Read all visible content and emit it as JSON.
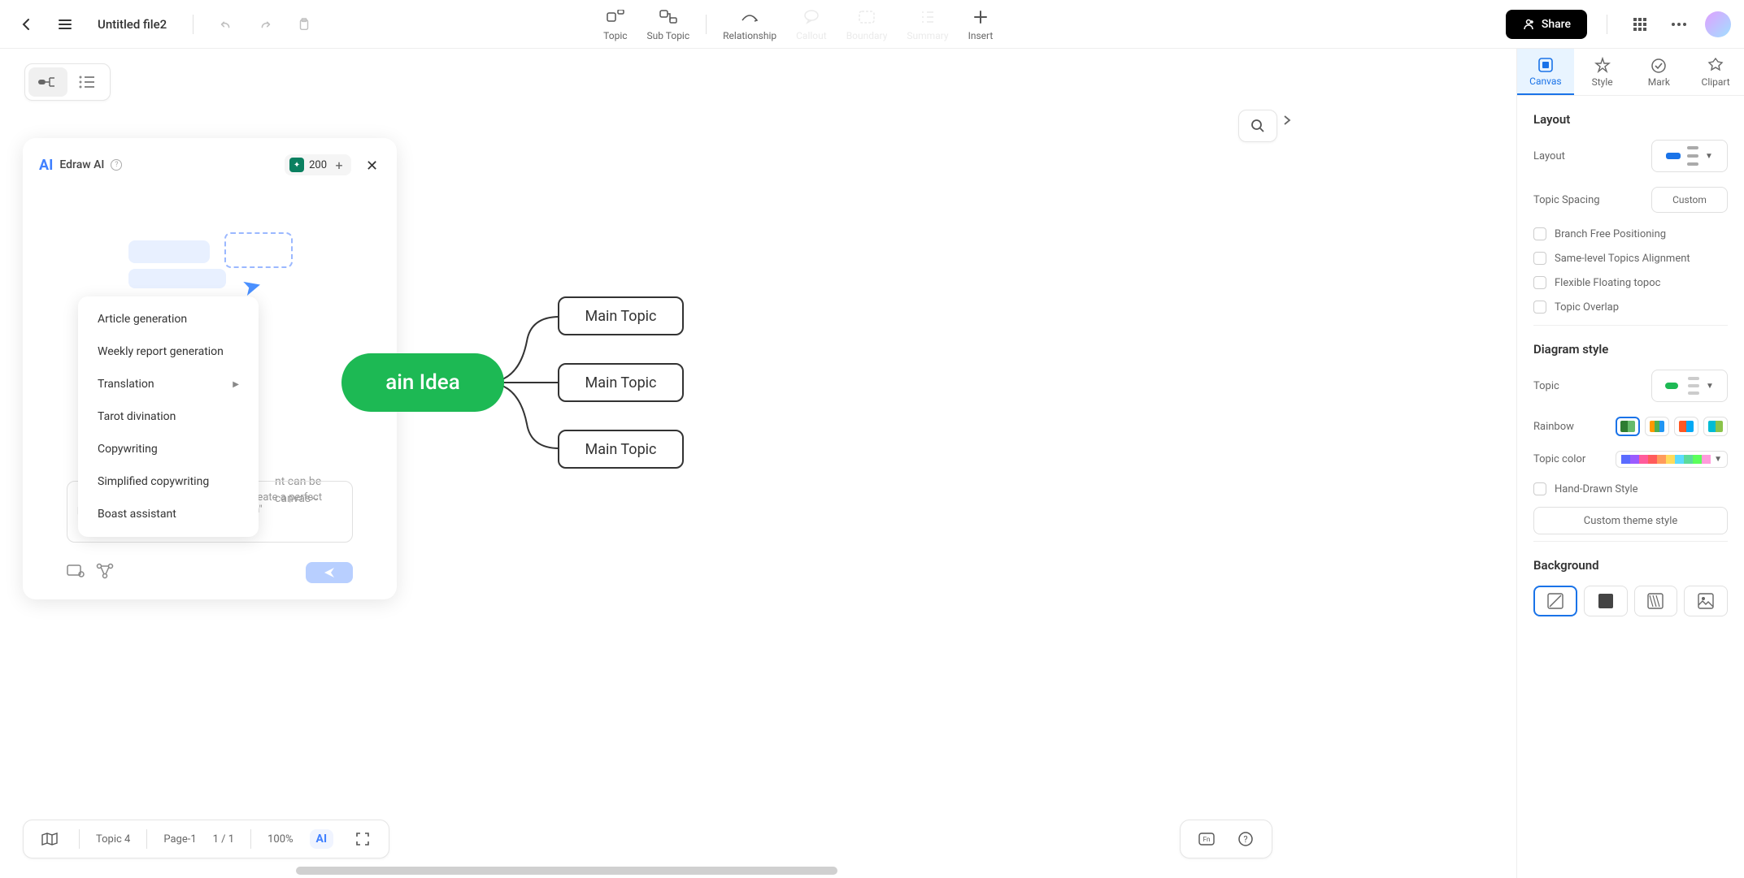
{
  "header": {
    "file_title": "Untitled file2",
    "share_label": "Share"
  },
  "tools": {
    "topic": "Topic",
    "sub_topic": "Sub Topic",
    "relationship": "Relationship",
    "callout": "Callout",
    "boundary": "Boundary",
    "summary": "Summary",
    "insert": "Insert"
  },
  "ai_panel": {
    "title": "Edraw AI",
    "tokens": "200",
    "ghost_line1": "nt can be",
    "ghost_line2": "canvas~",
    "placeholder": "Enter your requirement.e.g.\"Help me create a perfect poster\",\"set up a product-releasing plan\"",
    "menu": {
      "article": "Article generation",
      "weekly": "Weekly report generation",
      "translation": "Translation",
      "tarot": "Tarot divination",
      "copywriting": "Copywriting",
      "simplified": "Simplified copywriting",
      "boast": "Boast assistant"
    }
  },
  "mindmap": {
    "main_idea": "ain Idea",
    "topic1": "Main Topic",
    "topic2": "Main Topic",
    "topic3": "Main Topic"
  },
  "status": {
    "topic_count": "Topic 4",
    "page": "Page-1",
    "page_nav": "1 / 1",
    "zoom": "100%",
    "ai": "AI"
  },
  "right_panel": {
    "tabs": {
      "canvas": "Canvas",
      "style": "Style",
      "mark": "Mark",
      "clipart": "Clipart"
    },
    "layout_section": "Layout",
    "layout_label": "Layout",
    "topic_spacing": "Topic Spacing",
    "custom": "Custom",
    "branch_free": "Branch Free Positioning",
    "same_level": "Same-level Topics Alignment",
    "flexible": "Flexible Floating topoc",
    "overlap": "Topic Overlap",
    "diagram_style": "Diagram style",
    "topic_label": "Topic",
    "rainbow": "Rainbow",
    "topic_color": "Topic color",
    "hand_drawn": "Hand-Drawn Style",
    "custom_theme": "Custom theme style",
    "background": "Background"
  }
}
